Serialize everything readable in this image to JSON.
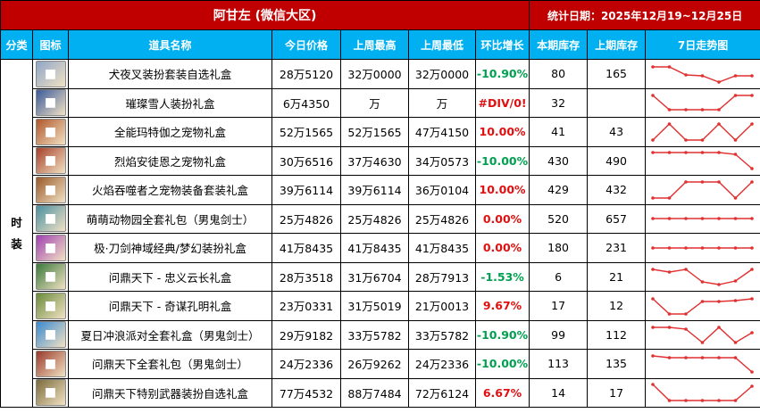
{
  "title": "阿甘左 (微信大区)",
  "period": "统计日期：2025年12月19~12月25日",
  "headers": [
    "分类",
    "图标",
    "道具名称",
    "今日价格",
    "上周最高",
    "上周最低",
    "环比增长",
    "本期库存",
    "上期库存",
    "7日走势图"
  ],
  "category": "时装",
  "colors": {
    "title_bg": "#c00000",
    "header_bg": "#00b0f0",
    "positive": "#e01010",
    "negative": "#00a050",
    "trend_line": "#e03030"
  },
  "rows": [
    {
      "name": "犬夜叉装扮套装自选礼盒",
      "today": "28万5120",
      "wk_high": "32万0000",
      "wk_low": "32万0000",
      "change": "-10.90%",
      "cur_stock": "80",
      "prev_stock": "165",
      "icon": "silver-haired-character-icon",
      "icon_color": "#8fa6c8",
      "trend": [
        0.9,
        0.9,
        0.45,
        0.4,
        0.05,
        0.4,
        0.4
      ]
    },
    {
      "name": "璀璨雪人装扮礼盒",
      "today": "6万4350",
      "wk_high": "万",
      "wk_low": "万",
      "change": "#DIV/0!",
      "cur_stock": "32",
      "prev_stock": "",
      "icon": "snowman-box-icon",
      "icon_color": "#3a5a9a",
      "trend": [
        0.9,
        0.1,
        0.1,
        0.1,
        0.1,
        0.9,
        0.9
      ]
    },
    {
      "name": "全能玛特伽之宠物礼盒",
      "today": "52万1565",
      "wk_high": "52万1565",
      "wk_low": "47万4150",
      "change": "10.00%",
      "cur_stock": "41",
      "prev_stock": "43",
      "icon": "pet-gift-box-icon",
      "icon_color": "#b0562a",
      "trend": [
        0.05,
        0.95,
        0.05,
        0.05,
        0.95,
        0.05,
        0.95
      ]
    },
    {
      "name": "烈焰安徒恩之宠物礼盒",
      "today": "30万6516",
      "wk_high": "37万4630",
      "wk_low": "34万0573",
      "change": "-10.00%",
      "cur_stock": "430",
      "prev_stock": "490",
      "icon": "flame-pet-box-icon",
      "icon_color": "#a6402a",
      "trend": [
        0.95,
        0.95,
        0.95,
        0.95,
        0.95,
        0.85,
        0.05
      ]
    },
    {
      "name": "火焰吞噬者之宠物装备套装礼盒",
      "today": "39万6114",
      "wk_high": "39万6114",
      "wk_low": "36万0104",
      "change": "10.00%",
      "cur_stock": "429",
      "prev_stock": "432",
      "icon": "flame-equipment-box-icon",
      "icon_color": "#9a5a2a",
      "trend": [
        0.05,
        0.05,
        0.95,
        0.95,
        0.95,
        0.05,
        0.95
      ]
    },
    {
      "name": "萌萌动物园全套礼包（男鬼剑士）",
      "today": "25万4826",
      "wk_high": "25万4826",
      "wk_low": "25万4826",
      "change": "0.00%",
      "cur_stock": "520",
      "prev_stock": "657",
      "icon": "zoo-package-icon",
      "icon_color": "#4a90a0",
      "trend": [
        0.5,
        0.5,
        0.5,
        0.5,
        0.5,
        0.5,
        0.5
      ]
    },
    {
      "name": "极·刀剑神域经典/梦幻装扮礼盒",
      "today": "41万8435",
      "wk_high": "41万8435",
      "wk_low": "41万8435",
      "change": "0.00%",
      "cur_stock": "180",
      "prev_stock": "231",
      "icon": "sword-art-box-icon",
      "icon_color": "#a040b0",
      "trend": [
        0.5,
        0.5,
        0.5,
        0.5,
        0.5,
        0.5,
        0.5
      ]
    },
    {
      "name": "问鼎天下 - 忠义云长礼盒",
      "today": "28万3518",
      "wk_high": "31万6704",
      "wk_low": "28万7913",
      "change": "-1.53%",
      "cur_stock": "6",
      "prev_stock": "21",
      "icon": "general-guan-icon",
      "icon_color": "#3a7a3a",
      "trend": [
        0.9,
        0.75,
        0.9,
        0.2,
        0.05,
        0.25,
        0.9
      ]
    },
    {
      "name": "问鼎天下 - 奇谋孔明礼盒",
      "today": "23万0331",
      "wk_high": "31万5019",
      "wk_low": "21万0013",
      "change": "9.67%",
      "cur_stock": "17",
      "prev_stock": "12",
      "icon": "strategist-kongming-icon",
      "icon_color": "#6a8a3a",
      "trend": [
        0.9,
        0.05,
        0.05,
        0.75,
        0.75,
        0.8,
        0.9
      ]
    },
    {
      "name": "夏日冲浪派对全套礼盒（男鬼剑士）",
      "today": "29万9182",
      "wk_high": "33万5782",
      "wk_low": "33万5782",
      "change": "-10.90%",
      "cur_stock": "99",
      "prev_stock": "112",
      "icon": "summer-surf-box-icon",
      "icon_color": "#3a8ad0",
      "trend": [
        0.9,
        0.9,
        0.8,
        0.05,
        0.9,
        0.05,
        0.6
      ]
    },
    {
      "name": "问鼎天下全套礼包（男鬼剑士）",
      "today": "24万2336",
      "wk_high": "26万9262",
      "wk_low": "24万2336",
      "change": "-10.00%",
      "cur_stock": "113",
      "prev_stock": "135",
      "icon": "conquest-package-icon",
      "icon_color": "#9a3a2a",
      "trend": [
        0.95,
        0.85,
        0.85,
        0.85,
        0.85,
        0.85,
        0.05
      ]
    },
    {
      "name": "问鼎天下特别武器装扮自选礼盒",
      "today": "77万4532",
      "wk_high": "88万7484",
      "wk_low": "72万6124",
      "change": "6.67%",
      "cur_stock": "14",
      "prev_stock": "17",
      "icon": "weapon-select-box-icon",
      "icon_color": "#7a6a3a",
      "trend": [
        0.95,
        0.05,
        0.05,
        0.05,
        0.05,
        0.05,
        0.85
      ]
    }
  ]
}
